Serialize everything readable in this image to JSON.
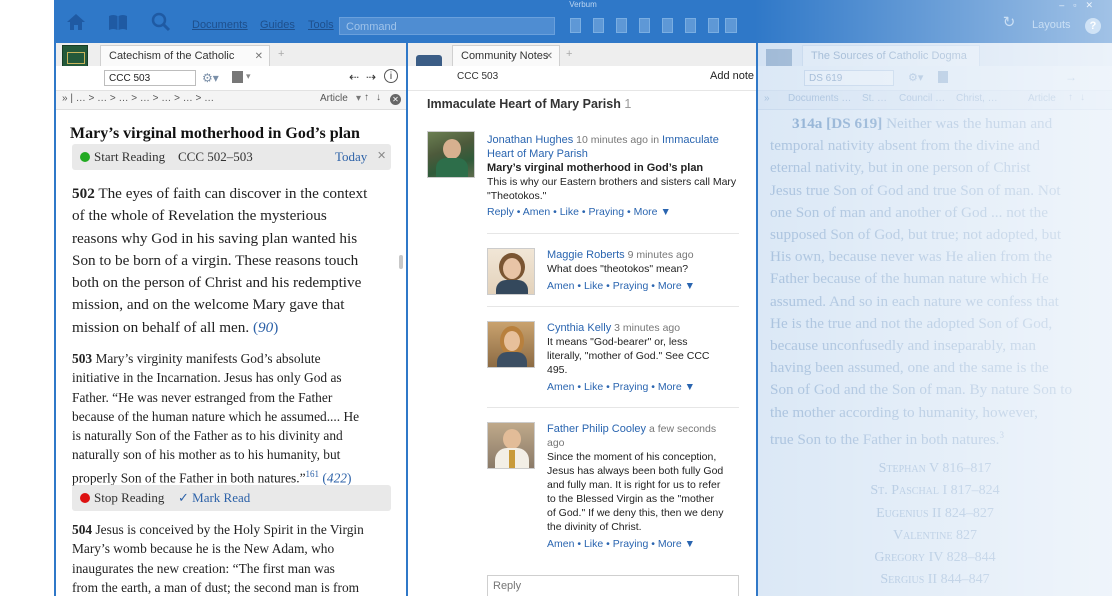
{
  "window": {
    "title": "Verbum"
  },
  "toolbar": {
    "menus": [
      "Documents",
      "Guides",
      "Tools"
    ],
    "command_placeholder": "Command",
    "layouts_label": "Layouts",
    "help_label": "?"
  },
  "left_pane": {
    "tab_title": "Catechism of the Catholic Church",
    "reference": "CCC 503",
    "breadcrumb": "» | … > … > … > … > … > … > …",
    "view_label": "Article",
    "heading": "Mary’s virginal motherhood in God’s plan",
    "reading_plan": {
      "start_label": "Start Reading",
      "range": "CCC 502–503",
      "today_label": "Today"
    },
    "para_502_number": "502",
    "para_502_lines": [
      "The eyes of faith can discover in the context",
      "of the whole of Revelation the mysterious",
      "reasons why God in his saving plan wanted his",
      "Son to be born of a virgin. These reasons touch",
      "both on the person of Christ and his redemptive",
      "mission, and on the welcome Mary gave that",
      "mission on behalf of all men."
    ],
    "para_502_ref": "90",
    "para_503_number": "503",
    "para_503_lines": [
      "Mary’s virginity manifests God’s absolute",
      "initiative in the Incarnation. Jesus has only God as",
      "Father. “He was never estranged from the Father",
      "because of the human nature which he assumed.... He",
      "is naturally Son of the Father as to his divinity and",
      "naturally son of his mother as to his humanity, but",
      "properly Son of the Father in both natures.”"
    ],
    "para_503_footnote": "161",
    "para_503_ref": "422",
    "stop_label": "Stop Reading",
    "mark_read_label": "✓ Mark Read",
    "para_504_number": "504",
    "para_504_lines": [
      "Jesus is conceived by the Holy Spirit in the Virgin",
      "Mary’s womb because he is the New Adam, who",
      "inaugurates the new creation: “The first man was",
      "from the earth, a man of dust; the second man is from"
    ]
  },
  "middle_pane": {
    "tab_title": "Community Notes",
    "reference": "CCC 503",
    "add_note_label": "Add note",
    "group_name": "Immaculate Heart of Mary Parish",
    "group_count": "1",
    "notes": [
      {
        "author": "Jonathan Hughes",
        "time": "10 minutes ago in",
        "group_link_1": "Immaculate",
        "group_link_2": "Heart of Mary Parish",
        "title": "Mary’s virginal motherhood in God’s plan",
        "lines": [
          "This is why our Eastern brothers and sisters call Mary",
          "\"Theotokos.\""
        ],
        "actions": "Reply • Amen • Like • Praying • More ▼"
      },
      {
        "author": "Maggie Roberts",
        "time": "9 minutes ago",
        "lines": [
          "What does \"theotokos\" mean?"
        ],
        "actions": "Amen • Like • Praying • More ▼"
      },
      {
        "author": "Cynthia Kelly",
        "time": "3 minutes ago",
        "lines": [
          "It means \"God-bearer\" or, less",
          "literally, \"mother of God.\" See CCC",
          "495."
        ],
        "actions": "Amen • Like • Praying • More ▼"
      },
      {
        "author": "Father Philip Cooley",
        "time": "a few seconds",
        "time_2": "ago",
        "lines": [
          "Since the moment of his conception,",
          "Jesus has always been both fully God",
          "and fully man. It is right for us to refer",
          "to the Blessed Virgin as the \"mother",
          "of God.\" If we deny this, then we deny",
          "the divinity of Christ."
        ],
        "actions": "Amen • Like • Praying • More ▼"
      }
    ],
    "reply_placeholder": "Reply"
  },
  "right_pane": {
    "tab_title": "The Sources of Catholic Dogma",
    "reference": "DS 619",
    "breadcrumb_items": [
      "Documents …",
      "St. …",
      "Council …",
      "Christ, …"
    ],
    "view_label": "Article",
    "para_number": "314a [DS 619]",
    "lines": [
      "Neither was the human and",
      "temporal nativity absent from the divine and",
      "eternal nativity, but in one person of Christ",
      "Jesus true Son of God and true Son of man. Not",
      "one Son of man and another of God ... not the",
      "supposed Son of God, but true; not adopted, but",
      "His own, because never was He alien from the",
      "Father because of the human nature which He",
      "assumed. And so in each nature we confess that",
      "He is the true and not the adopted Son of God,",
      "because unconfusedly and inseparably, man",
      "having been assumed, one and the same is the",
      "Son of God and the Son of man. By nature Son to",
      "the mother according to humanity, however,",
      "true Son to the Father in both natures."
    ],
    "footnote": "3",
    "popes": [
      "Stephan V 816–817",
      "St. Paschal I 817–824",
      "Eugenius II 824–827",
      "Valentine 827",
      "Gregory IV 828–844",
      "Sergius II 844–847"
    ]
  },
  "colors": {
    "accent": "#2f78c8",
    "link": "#2a65b0",
    "start_dot": "#22aa22",
    "stop_dot": "#dd1111"
  }
}
